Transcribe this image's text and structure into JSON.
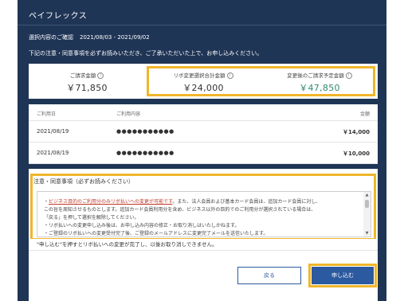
{
  "title": "ペイフレックス",
  "selection": {
    "label": "選択内容のご確認",
    "period": "2021/08/03 - 2021/09/02"
  },
  "notice": "下記の注意・同意事項を必ずお読みいただき、ご了承いただいた上で、お申し込みください。",
  "summary": [
    {
      "label": "ご請求金額",
      "value": "￥71,850",
      "color": "#333333"
    },
    {
      "label": "リボ変更選択合計金額",
      "value": "￥24,000",
      "color": "#333333"
    },
    {
      "label": "変更後のご請求予定金額",
      "value": "￥47,850",
      "color": "#2e8b6e"
    }
  ],
  "table": {
    "headers": [
      "ご利用日",
      "ご利用内容",
      "金額"
    ],
    "rows": [
      {
        "date": "2021/08/19",
        "content": "●●●●●●●●●●●",
        "amount": "￥14,000"
      },
      {
        "date": "2021/08/19",
        "content": "●●●●●●●●●●●",
        "amount": "￥10,000"
      }
    ]
  },
  "terms": {
    "heading": "注意・同意事項（必ずお読みください）",
    "lines": [
      {
        "pre": "・",
        "emph": "ビジネス目的のご利用分のみリボ払いへの変更が可能です",
        "post": "。また、法人会員および基本カード会員は、追加カード会員に対し、"
      },
      {
        "pre": "",
        "emph": "",
        "post": "この旨を周知させるものとします。追加カード会員利用分を含め、ビジネス以外の目的でのご利用分が選択されている場合は、"
      },
      {
        "pre": "",
        "emph": "",
        "post": "「戻る」を押して選択を解除してください。"
      },
      {
        "pre": "",
        "emph": "",
        "post": "・リボ払いへの変更申し込み後は、お申し込み内容の修正・お取り消しはいたしかねます。"
      },
      {
        "pre": "",
        "emph": "",
        "post": "・ご登録のリボ払いへの変更受付完了後、ご登録のメールアドレスに変更完了メールを送信いたします。"
      }
    ]
  },
  "footnote": "\"申し込む\"を押すとリボ払いへの変更が完了し、以後お取り消しできません。",
  "buttons": {
    "back": "戻る",
    "apply": "申し込む"
  },
  "colors": {
    "header_bg": "#1f3556",
    "highlight": "#f0b62a",
    "primary": "#2c5aa0"
  },
  "icons": {
    "info": "info-icon",
    "scroll_up": "triangle-up",
    "scroll_down": "triangle-down"
  }
}
